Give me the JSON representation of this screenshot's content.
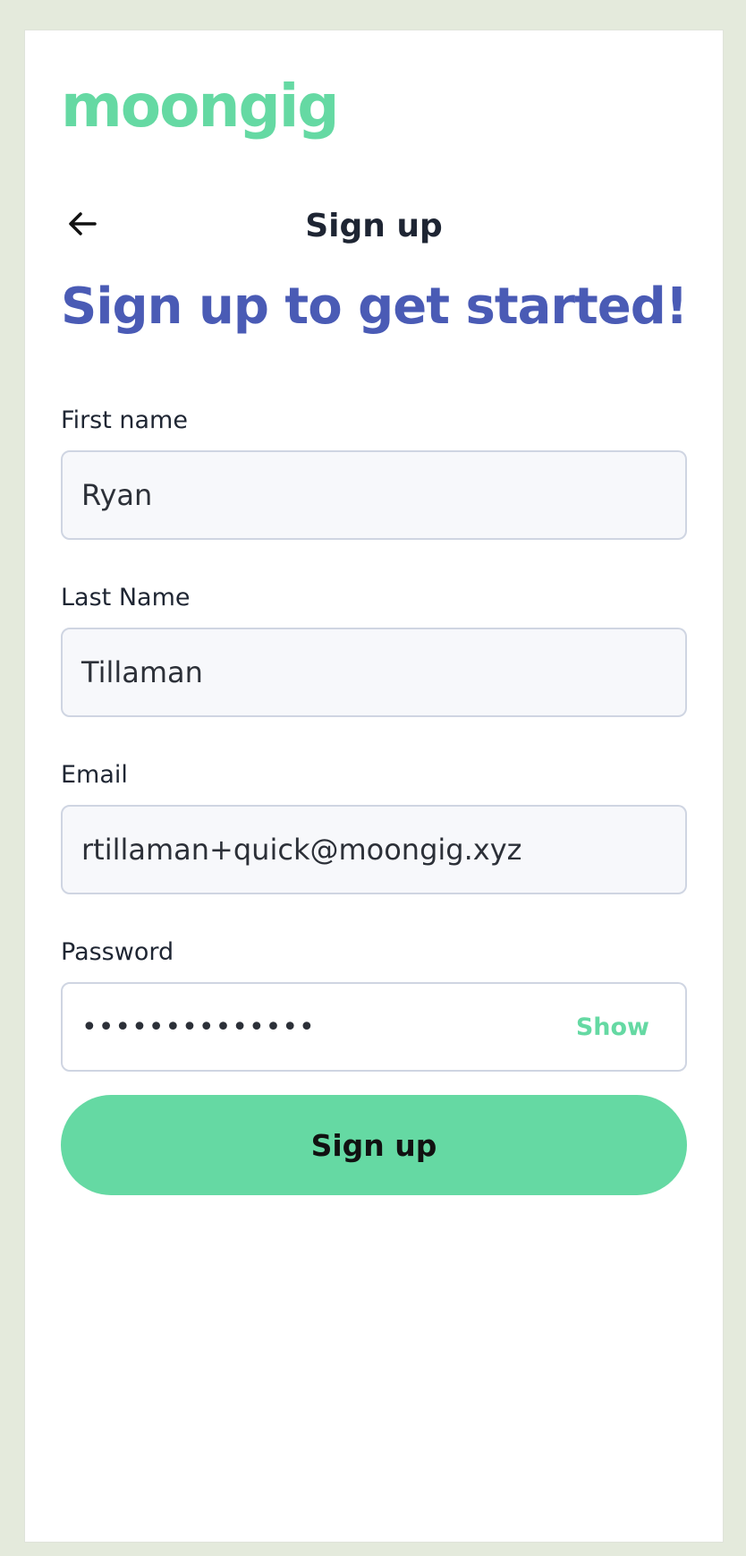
{
  "logo": {
    "text": "moongig"
  },
  "header": {
    "title": "Sign up"
  },
  "headline": "Sign up to get started!",
  "form": {
    "first_name": {
      "label": "First name",
      "value": "Ryan"
    },
    "last_name": {
      "label": "Last Name",
      "value": "Tillaman"
    },
    "email": {
      "label": "Email",
      "value": "rtillaman+quick@moongig.xyz"
    },
    "password": {
      "label": "Password",
      "masked_value": "••••••••••••••",
      "show_label": "Show"
    },
    "submit_label": "Sign up"
  },
  "colors": {
    "brand_green": "#65d9a3",
    "headline_blue": "#4a5bb5",
    "background": "#e4eadc"
  },
  "icons": {
    "back": "arrow-left-icon"
  }
}
